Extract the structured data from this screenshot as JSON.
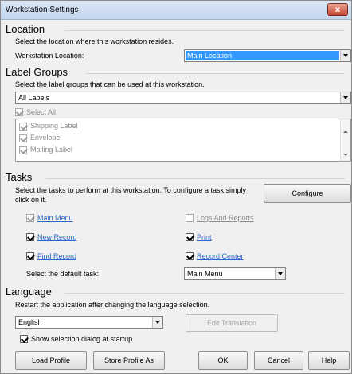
{
  "window": {
    "title": "Workstation Settings",
    "close_label": "x"
  },
  "location": {
    "heading": "Location",
    "description": "Select the location where this workstation resides.",
    "field_label": "Workstation Location:",
    "field_value": "Main Location"
  },
  "label_groups": {
    "heading": "Label Groups",
    "description": "Select the label groups that can be used at this workstation.",
    "dropdown_value": "All Labels",
    "select_all_label": "Select All",
    "items": [
      {
        "label": "Shipping Label",
        "checked": true
      },
      {
        "label": "Envelope",
        "checked": true
      },
      {
        "label": "Mailing Label",
        "checked": true
      }
    ]
  },
  "tasks": {
    "heading": "Tasks",
    "description_line1": "Select the tasks to perform at this workstation. To configure a task simply",
    "description_line2": "click on it.",
    "configure_label": "Configure",
    "items": [
      {
        "label": "Main Menu",
        "checked": true,
        "enabled": false
      },
      {
        "label": "Logs And Reports",
        "checked": false,
        "enabled": false
      },
      {
        "label": "New Record",
        "checked": true,
        "enabled": true
      },
      {
        "label": "Print",
        "checked": true,
        "enabled": true
      },
      {
        "label": "Find Record",
        "checked": true,
        "enabled": true
      },
      {
        "label": "Record Center",
        "checked": true,
        "enabled": true
      }
    ],
    "default_task_label": "Select the default task:",
    "default_task_value": "Main Menu"
  },
  "language": {
    "heading": "Language",
    "description": "Restart the application after changing the language selection.",
    "dropdown_value": "English",
    "edit_translation_label": "Edit Translation",
    "show_dialog_label": "Show selection dialog at startup",
    "show_dialog_checked": true
  },
  "footer": {
    "load_profile": "Load Profile",
    "store_profile_as": "Store Profile As",
    "ok": "OK",
    "cancel": "Cancel",
    "help": "Help"
  },
  "colors": {
    "link": "#2b67c6",
    "selection": "#3399ff",
    "close_button": "#c8442d"
  }
}
